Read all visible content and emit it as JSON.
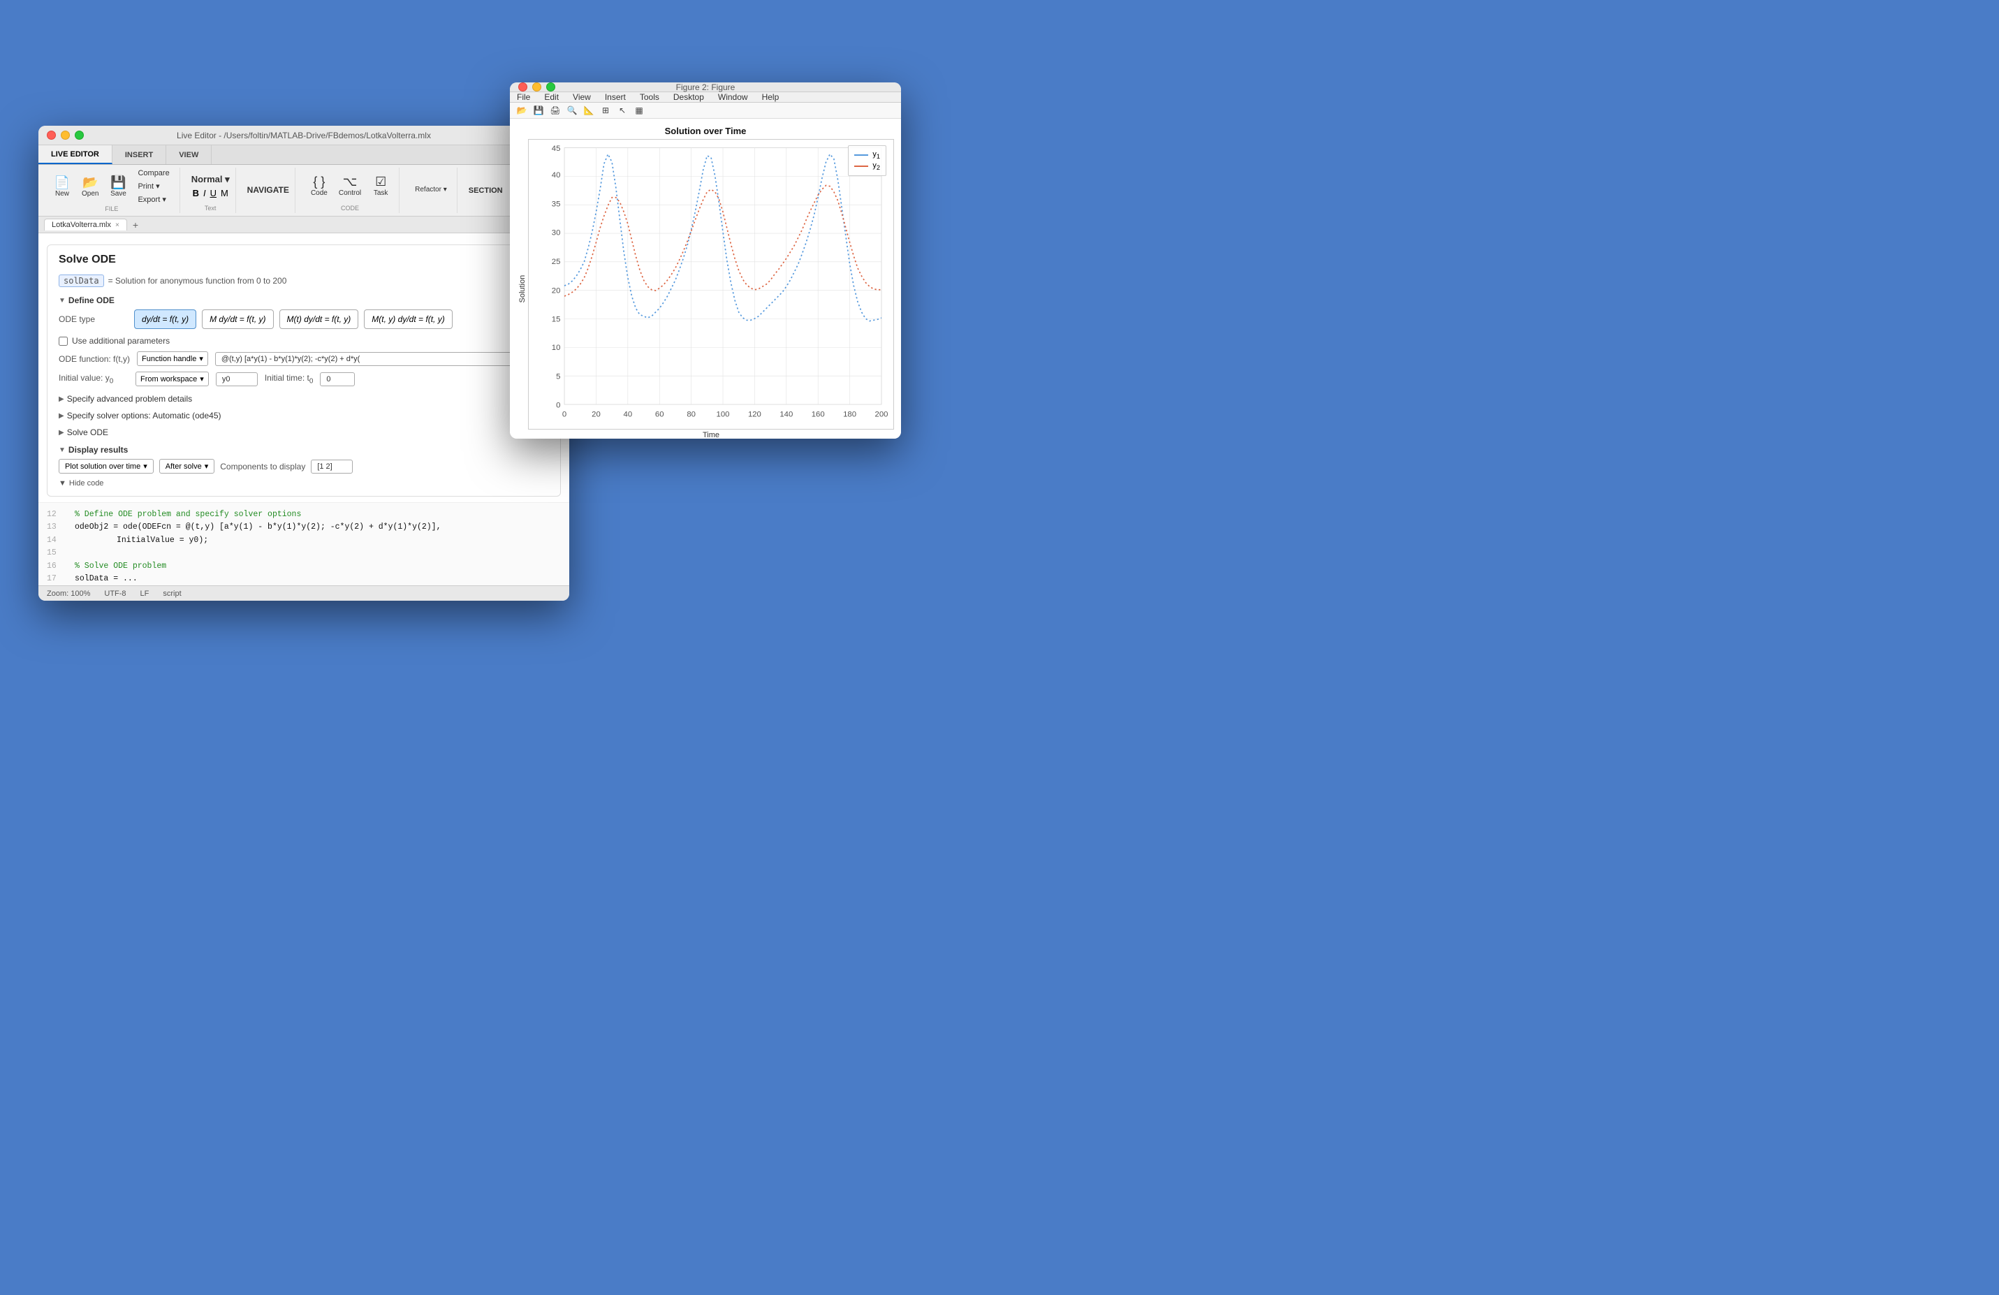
{
  "background": "#4a7cc7",
  "editorWindow": {
    "title": "Live Editor - /Users/foltin/MATLAB-Drive/FBdemos/LotkaVolterra.mlx",
    "tabs": [
      {
        "label": "LIVE EDITOR",
        "active": true
      },
      {
        "label": "INSERT",
        "active": false
      },
      {
        "label": "VIEW",
        "active": false
      }
    ],
    "ribbon": {
      "fileGroup": {
        "label": "FILE",
        "buttons": [
          {
            "label": "New",
            "icon": "📄"
          },
          {
            "label": "Open",
            "icon": "📂"
          },
          {
            "label": "Save",
            "icon": "💾"
          }
        ],
        "smallButtons": [
          {
            "label": "Compare"
          },
          {
            "label": "Print ▾"
          },
          {
            "label": "Export ▾"
          }
        ]
      },
      "textGroup": {
        "label": "TEXT",
        "main": "Text",
        "normal": "Normal ▾"
      },
      "navigateGroup": {
        "label": "",
        "main": "NAVIGATE"
      },
      "codeGroup": {
        "label": "CODE",
        "buttons": [
          "Code",
          "Control",
          "Task"
        ]
      }
    },
    "docTab": {
      "filename": "LotkaVolterra.mlx",
      "closeBtn": "×",
      "addBtn": "+"
    },
    "odeBlock": {
      "title": "Solve ODE",
      "varName": "solData",
      "description": "= Solution for anonymous function from 0 to 200",
      "defineODE": {
        "header": "Define ODE",
        "odetype_label": "ODE type",
        "equations": [
          {
            "label": "dy/dt = f(t,y)",
            "selected": true
          },
          {
            "label": "M dy/dt = f(t,y)",
            "selected": false
          },
          {
            "label": "M(t) dy/dt = f(t,y)",
            "selected": false
          },
          {
            "label": "M(t,y) dy/dt = f(t,y)",
            "selected": false
          }
        ],
        "checkbox": "Use additional parameters",
        "odeFunction_label": "ODE function: f(t,y)",
        "odeFunction_select": "Function handle",
        "odeFunction_value": "@(t,y) [a*y(1) - b*y(1)*y(2); -c*y(2) + d*y(",
        "initialValue_label": "Initial value: y₀",
        "initialValue_select": "From workspace",
        "initialValue_value": "y0",
        "initialTime_label": "Initial time: t₀",
        "initialTime_value": "0"
      },
      "advancedSection": "Specify advanced problem details",
      "solverSection": "Specify solver options: Automatic (ode45)",
      "solveSection": "Solve ODE",
      "displayResults": {
        "header": "Display results",
        "plotDropdown": "Plot solution over time",
        "afterDropdown": "After solve",
        "componentsLabel": "Components to display",
        "componentsValue": "[1 2]"
      },
      "hideCode": "Hide code"
    },
    "codeLines": [
      {
        "num": "12",
        "text": "% Define ODE problem and specify solver options",
        "type": "comment"
      },
      {
        "num": "13",
        "text": "odeObj2 = ode(ODEFcn = @(t,y) [a*y(1) - b*y(1)*y(2); -c*y(2) + d*y(1)*y(2)],",
        "type": "code"
      },
      {
        "num": "14",
        "text": "     InitialValue = y0);",
        "type": "code"
      },
      {
        "num": "15",
        "text": "",
        "type": "code"
      },
      {
        "num": "16",
        "text": "% Solve ODE problem",
        "type": "comment"
      },
      {
        "num": "17",
        "text": "solData = ...",
        "type": "code"
      }
    ],
    "statusBar": {
      "zoom": "Zoom: 100%",
      "encoding": "UTF-8",
      "lineEnding": "LF",
      "type": "script"
    }
  },
  "figureWindow": {
    "title": "Figure 2: Figure",
    "menuItems": [
      "File",
      "Edit",
      "View",
      "Insert",
      "Tools",
      "Desktop",
      "Window",
      "Help"
    ],
    "toolbarIcons": [
      "📁",
      "💾",
      "🖨",
      "🔍",
      "📐",
      "📊",
      "↩",
      "⊞"
    ],
    "plot": {
      "title": "Solution over Time",
      "yLabel": "Solution",
      "xLabel": "Time",
      "xTicks": [
        0,
        20,
        40,
        60,
        80,
        100,
        120,
        140,
        160,
        180,
        200
      ],
      "yTicks": [
        0,
        5,
        10,
        15,
        20,
        25,
        30,
        35,
        40,
        45
      ],
      "legend": [
        {
          "label": "y₁",
          "color": "#5599dd"
        },
        {
          "label": "y₂",
          "color": "#dd6644"
        }
      ]
    }
  }
}
